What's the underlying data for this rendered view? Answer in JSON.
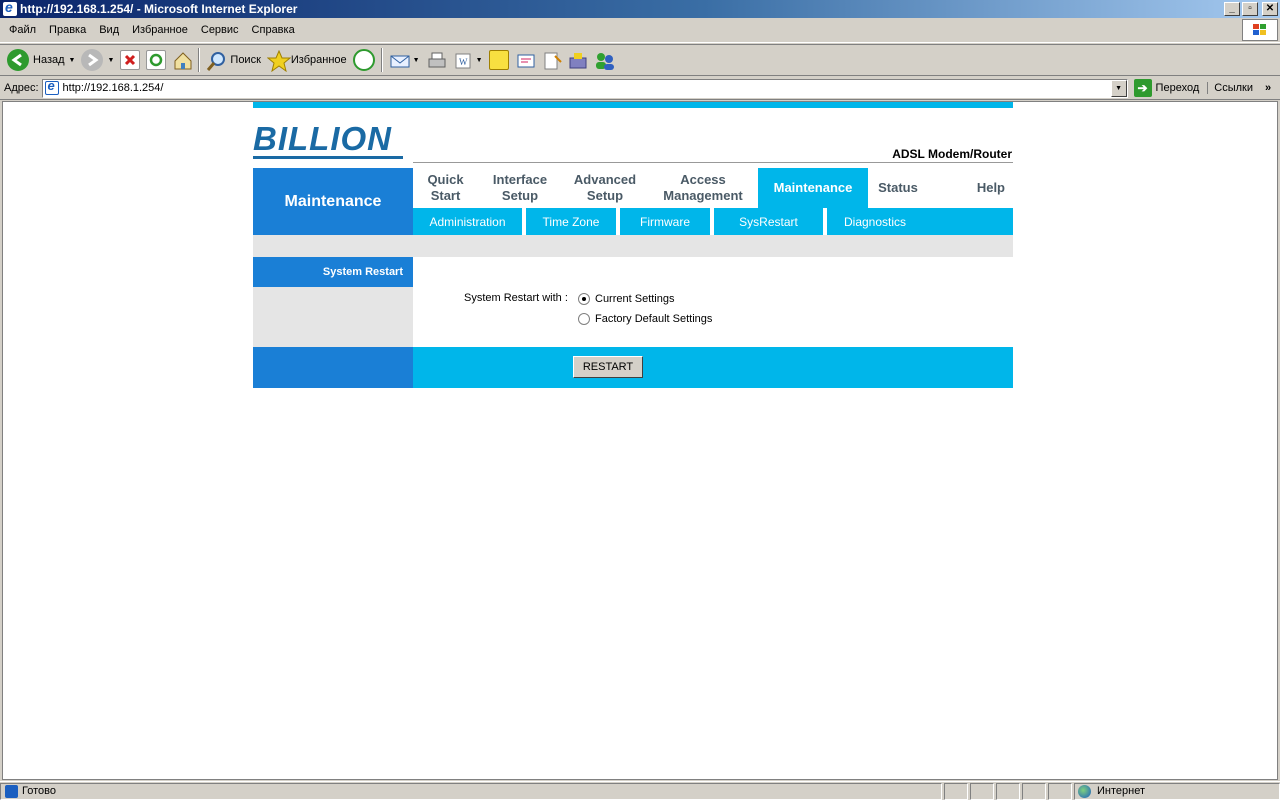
{
  "window": {
    "title": "http://192.168.1.254/ - Microsoft Internet Explorer",
    "buttons": {
      "minimize": "_",
      "maximize": "▫",
      "close": "✕"
    }
  },
  "menubar": {
    "items": [
      "Файл",
      "Правка",
      "Вид",
      "Избранное",
      "Сервис",
      "Справка"
    ]
  },
  "toolbar": {
    "back_label": "Назад",
    "search_label": "Поиск",
    "favorites_label": "Избранное"
  },
  "addressbar": {
    "label": "Адрес:",
    "url": "http://192.168.1.254/",
    "go_label": "Переход",
    "links_label": "Ссылки"
  },
  "router": {
    "logo": "BILLION",
    "product": "ADSL Modem/Router",
    "section": "Maintenance",
    "tabs": [
      {
        "label": "Quick\nStart",
        "line1": "Quick",
        "line2": "Start",
        "active": false
      },
      {
        "label": "Interface Setup",
        "line1": "Interface",
        "line2": "Setup",
        "active": false
      },
      {
        "label": "Advanced Setup",
        "line1": "Advanced",
        "line2": "Setup",
        "active": false
      },
      {
        "label": "Access Management",
        "line1": "Access",
        "line2": "Management",
        "active": false
      },
      {
        "label": "Maintenance",
        "line1": "Maintenance",
        "line2": "",
        "active": true
      },
      {
        "label": "Status",
        "line1": "Status",
        "line2": "",
        "active": false
      },
      {
        "label": "Help",
        "line1": "Help",
        "line2": "",
        "active": false
      }
    ],
    "subtabs": [
      "Administration",
      "Time Zone",
      "Firmware",
      "SysRestart",
      "Diagnostics"
    ],
    "side_heading": "System Restart",
    "restart_with_label": "System Restart with :",
    "options": [
      {
        "label": "Current Settings",
        "checked": true
      },
      {
        "label": "Factory Default Settings",
        "checked": false
      }
    ],
    "restart_button": "RESTART"
  },
  "statusbar": {
    "status": "Готово",
    "zone": "Интернет"
  },
  "colors": {
    "brand_blue": "#1a7fd6",
    "accent_cyan": "#00b6ea",
    "logo_blue": "#1a6aa4"
  }
}
